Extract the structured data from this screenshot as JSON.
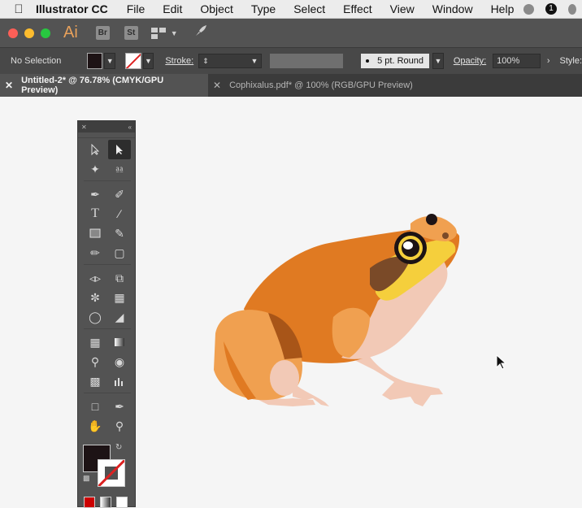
{
  "menubar": {
    "app_name": "Illustrator CC",
    "items": [
      "File",
      "Edit",
      "Object",
      "Type",
      "Select",
      "Effect",
      "View",
      "Window",
      "Help"
    ],
    "notification_count": "1"
  },
  "appbar": {
    "logo": "Ai",
    "bridge": "Br",
    "stock": "St"
  },
  "control": {
    "selection": "No Selection",
    "stroke_label": "Stroke:",
    "brush": "5 pt. Round",
    "opacity_label": "Opacity:",
    "opacity_value": "100%",
    "style_label": "Style:"
  },
  "tabs": [
    {
      "label": "Untitled-2* @ 76.78% (CMYK/GPU Preview)",
      "active": true
    },
    {
      "label": "Cophixalus.pdf* @ 100% (RGB/GPU Preview)",
      "active": false
    }
  ],
  "colors": {
    "fill": "#1d1315",
    "stroke_none": "#dd2222",
    "frog_body": "#e07a22",
    "frog_light": "#f0a050",
    "frog_belly": "#f2c9b6",
    "frog_dark": "#a85518",
    "frog_eye_ring": "#f5cf3c"
  },
  "tools": [
    "selection-tool",
    "direct-selection-tool",
    "magic-wand-tool",
    "lasso-tool",
    "pen-tool",
    "curvature-tool",
    "type-tool",
    "line-tool",
    "rectangle-tool",
    "paintbrush-tool",
    "pencil-tool",
    "eraser-tool",
    "reflect-tool",
    "scale-tool",
    "warp-tool",
    "free-transform-tool",
    "shape-builder-tool",
    "perspective-grid-tool",
    "mesh-tool",
    "gradient-tool",
    "eyedropper-tool",
    "blend-tool",
    "symbol-sprayer-tool",
    "column-graph-tool",
    "artboard-tool",
    "slice-tool",
    "hand-tool",
    "zoom-tool"
  ]
}
